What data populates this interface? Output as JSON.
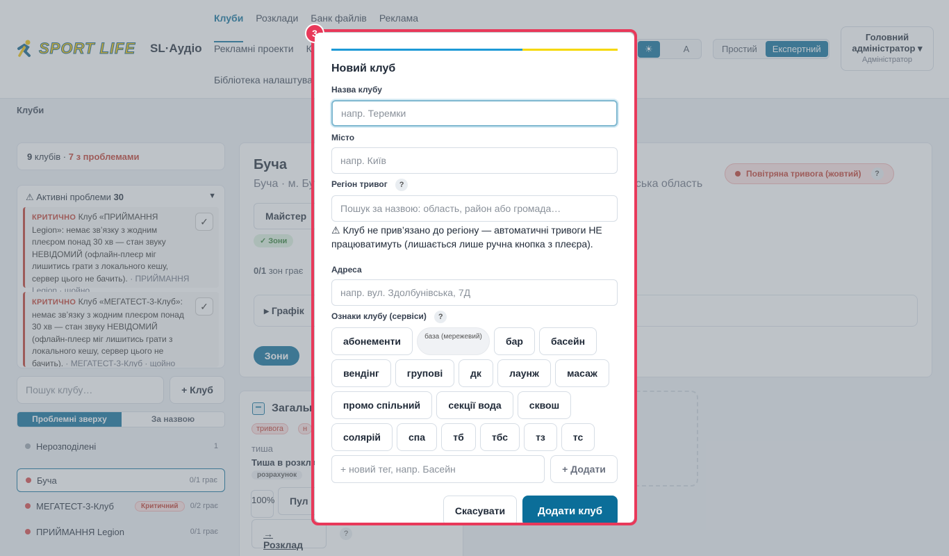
{
  "brand": {
    "logo_text": "SPORT LIFE",
    "product": "SL·Аудіо"
  },
  "nav": {
    "row1": [
      "Клуби",
      "Розклади",
      "Банк файлів",
      "Реклама"
    ],
    "row2": [
      "Рекламні проекти",
      "К"
    ],
    "row3": [
      "Бібліотека налаштува"
    ]
  },
  "theme_switch": {
    "items": [
      "☀",
      "",
      "A"
    ],
    "selected": "☀"
  },
  "mode_switch": {
    "items": [
      "Простий",
      "Експертний"
    ],
    "selected": "Експертний"
  },
  "user": {
    "name": "Головний адміністратор ▾",
    "role": "Адміністратор"
  },
  "breadcrumb": "Клуби",
  "summary": {
    "count": "9",
    "count_label": "клубів ·",
    "problems": "7 з проблемами"
  },
  "problems_panel": {
    "title": "⚠ Активні проблеми",
    "count": "30",
    "items": [
      {
        "severity": "КРИТИЧНО",
        "text": "Клуб «ПРИЙМАННЯ Legion»: немає зв’язку з жодним плеєром понад 30 хв — стан звуку НЕВІДОМИЙ (офлайн-плеєр міг лишитись грати з локального кешу, сервер цього не бачить).",
        "meta": "· ПРИЙМАННЯ Legion · щойно"
      },
      {
        "severity": "КРИТИЧНО",
        "text": "Клуб «МЕГАТЕСТ-3-Клуб»: немає зв’язку з жодним плеєром понад 30 хв — стан звуку НЕВІДОМИЙ (офлайн-плеєр міг лишитись грати з локального кешу, сервер цього не бачить).",
        "meta": "· МЕГАТЕСТ-3-Клуб · щойно"
      }
    ]
  },
  "club_search": {
    "placeholder": "Пошук клубу…",
    "add_label": "+ Клуб"
  },
  "sort_tabs": [
    "Проблемні зверху",
    "За назвою"
  ],
  "clubs": [
    {
      "name": "Нерозподілені",
      "count": "1",
      "color": "#9aa3ad"
    },
    {
      "name": "Буча",
      "count": "0/1 грає",
      "color": "#d64545"
    },
    {
      "name": "МЕГАТЕСТ-3-Клуб",
      "badge": "Критичний",
      "count": "0/2 грає",
      "color": "#d64545"
    },
    {
      "name": "ПРИЙМАННЯ Legion",
      "count": "0/1 грає",
      "color": "#d64545"
    }
  ],
  "detail": {
    "title": "Буча",
    "subtitle": "Буча · м. Бу",
    "subtitle_right": "івська область",
    "alert_badge": "Повітряна тривога (жовтий)",
    "master": "Майстер",
    "zones_badge": "✓ Зони",
    "playing": "0/1",
    "playing_label": "зон грає",
    "schedule_toggle": "▸ Графік",
    "zones_button": "Зони",
    "zone_card": {
      "title": "Загалы",
      "tags": [
        "тривога",
        "н"
      ],
      "state_label": "тиша",
      "state_text": "Тиша в розкла",
      "chip": "розрахунок",
      "volume": "100%",
      "pult": "Пул",
      "schedule_link": "→ Розклад"
    }
  },
  "modal": {
    "step": "3",
    "title": "Новий клуб",
    "name_label": "Назва клубу",
    "name_placeholder": "напр. Теремки",
    "city_label": "Місто",
    "city_placeholder": "напр. Київ",
    "region_label": "Регіон тривог",
    "region_placeholder": "Пошук за назвою: область, район або громада…",
    "region_warning": "⚠ Клуб не прив’язано до регіону — автоматичні тривоги НЕ працюватимуть (лишається лише ручна кнопка з плеєра).",
    "address_label": "Адреса",
    "address_placeholder": "напр. вул. Здолбунівська, 7Д",
    "tags_label": "Ознаки клубу (сервіси)",
    "help": "?",
    "tags": [
      "абонементи",
      "база (мережевий)",
      "бар",
      "басейн",
      "вендінг",
      "групові",
      "дк",
      "лаунж",
      "масаж",
      "промо спільний",
      "секції вода",
      "сквош",
      "солярій",
      "спа",
      "тб",
      "тбс",
      "тз",
      "тс"
    ],
    "selected_tag": "база (мережевий)",
    "new_tag_placeholder": "+ новий тег, напр. Басейн",
    "add_tag_label": "+ Додати",
    "cancel_label": "Скасувати",
    "submit_label": "Додати клуб"
  },
  "colors": {
    "accent": "#0b6e99",
    "danger": "#c0392b",
    "highlight": "#e8395a",
    "brand_yellow": "#f5d800",
    "brand_blue": "#1e9ad6"
  }
}
